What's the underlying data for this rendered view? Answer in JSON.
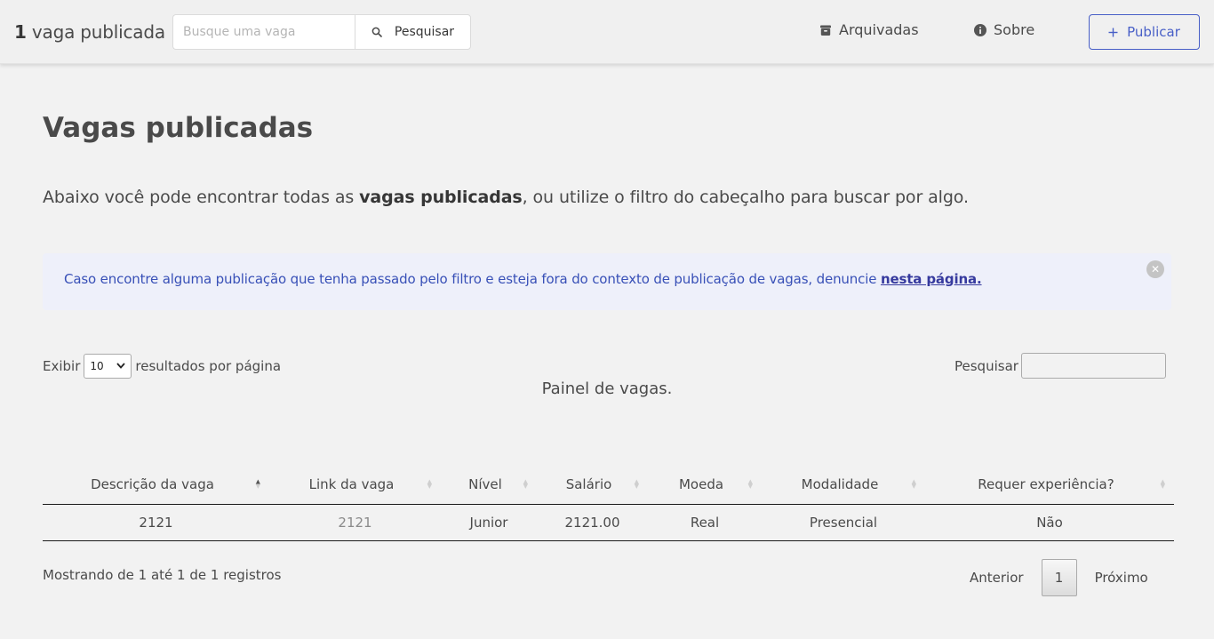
{
  "header": {
    "brand_count": "1",
    "brand_text": "vaga publicada",
    "search_placeholder": "Busque uma vaga",
    "search_button": "Pesquisar",
    "archived_label": "Arquivadas",
    "about_label": "Sobre",
    "publish_label": "Publicar"
  },
  "main": {
    "title": "Vagas publicadas",
    "intro_before": "Abaixo você pode encontrar todas as ",
    "intro_bold": "vagas publicadas",
    "intro_after": ", ou utilize o filtro do cabeçalho para buscar por algo.",
    "notice_text": "Caso encontre alguma publicação que tenha passado pelo filtro e esteja fora do contexto de publicação de vagas, denuncie ",
    "notice_link": "nesta página."
  },
  "table_controls": {
    "show_label": "Exibir",
    "page_size": "10",
    "per_page_label": "resultados por página",
    "filter_label": "Pesquisar",
    "caption": "Painel de vagas."
  },
  "table": {
    "columns": [
      "Descrição da vaga",
      "Link da vaga",
      "Nível",
      "Salário",
      "Moeda",
      "Modalidade",
      "Requer experiência?"
    ],
    "rows": [
      [
        "2121",
        "2121",
        "Junior",
        "2121.00",
        "Real",
        "Presencial",
        "Não"
      ]
    ]
  },
  "footer": {
    "info": "Mostrando de 1 até 1 de 1 registros",
    "prev": "Anterior",
    "current_page": "1",
    "next": "Próximo"
  },
  "colors": {
    "accent": "#485fc7",
    "notice_bg": "#eef0fa",
    "page_bg": "#f2f2f2"
  }
}
